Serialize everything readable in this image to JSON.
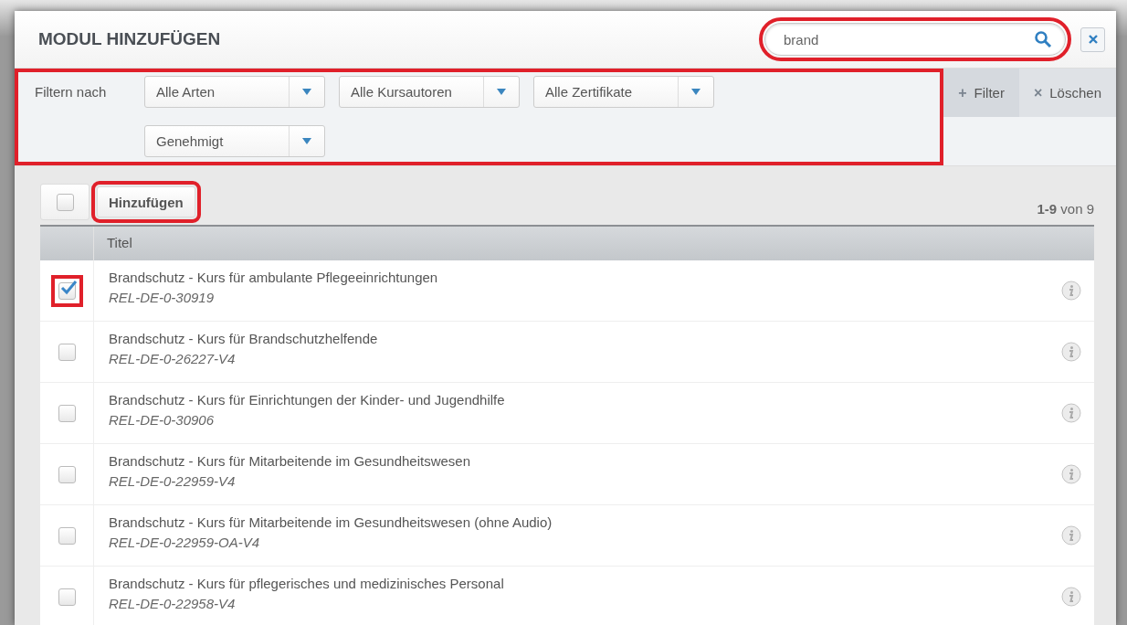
{
  "dialog": {
    "title": "MODUL HINZUFÜGEN",
    "search": {
      "value": "brand",
      "highlighted": true
    }
  },
  "filter_bar": {
    "label": "Filtern nach",
    "highlighted": true,
    "dropdowns": [
      {
        "value": "Alle Arten"
      },
      {
        "value": "Alle Kursautoren"
      },
      {
        "value": "Alle Zertifikate"
      },
      {
        "value": "Genehmigt"
      }
    ],
    "add_filter": {
      "icon": "+",
      "label": "Filter"
    },
    "clear": {
      "icon": "×",
      "label": "Löschen"
    }
  },
  "toolbar": {
    "select_all": {
      "checked": false
    },
    "add_button": {
      "label": "Hinzufügen",
      "highlighted": true
    },
    "pagination": "**1-9** von 9"
  },
  "table": {
    "columns": [
      "Titel"
    ],
    "rows": [
      {
        "title": "Brandschutz - Kurs für ambulante Pflegeeinrichtungen",
        "code": "REL-DE-0-30919",
        "checked": true,
        "highlighted": true
      },
      {
        "title": "Brandschutz - Kurs für Brandschutzhelfende",
        "code": "REL-DE-0-26227-V4",
        "checked": false,
        "highlighted": false
      },
      {
        "title": "Brandschutz - Kurs für Einrichtungen der Kinder- und Jugendhilfe",
        "code": "REL-DE-0-30906",
        "checked": false,
        "highlighted": false
      },
      {
        "title": "Brandschutz - Kurs für Mitarbeitende im Gesundheitswesen",
        "code": "REL-DE-0-22959-V4",
        "checked": false,
        "highlighted": false
      },
      {
        "title": "Brandschutz - Kurs für Mitarbeitende im Gesundheitswesen (ohne Audio)",
        "code": "REL-DE-0-22959-OA-V4",
        "checked": false,
        "highlighted": false
      },
      {
        "title": "Brandschutz - Kurs für pflegerisches und medizinisches Personal",
        "code": "REL-DE-0-22958-V4",
        "checked": false,
        "highlighted": false
      }
    ]
  }
}
